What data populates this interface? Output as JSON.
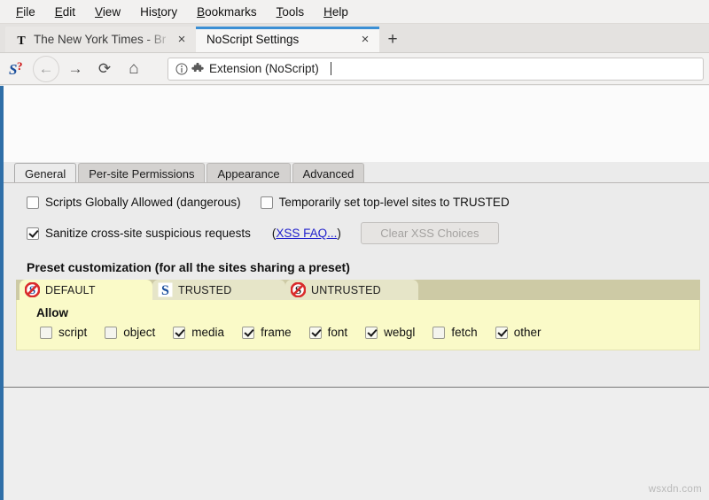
{
  "browser": {
    "menubar": [
      {
        "pre": "",
        "accel": "F",
        "post": "ile"
      },
      {
        "pre": "",
        "accel": "E",
        "post": "dit"
      },
      {
        "pre": "",
        "accel": "V",
        "post": "iew"
      },
      {
        "pre": "His",
        "accel": "t",
        "post": "ory"
      },
      {
        "pre": "",
        "accel": "B",
        "post": "ookmarks"
      },
      {
        "pre": "",
        "accel": "T",
        "post": "ools"
      },
      {
        "pre": "",
        "accel": "H",
        "post": "elp"
      }
    ],
    "tabs": [
      {
        "title": "The New York Times - Br",
        "favicon": "nyt-gothic-t-icon",
        "active": false,
        "close_glyph": "×"
      },
      {
        "title": "NoScript Settings",
        "favicon": "",
        "active": true,
        "close_glyph": "×"
      }
    ],
    "new_tab_glyph": "+",
    "nav": {
      "back_glyph": "←",
      "forward_glyph": "→",
      "reload_glyph": "⟳",
      "home_glyph": "⌂",
      "logo_name": "noscript-logo"
    },
    "urlbar": {
      "value": "Extension (NoScript)",
      "info_icon": "info-icon",
      "extension_icon": "puzzle-piece-icon"
    }
  },
  "options": {
    "tabs": [
      {
        "label": "General",
        "active": true
      },
      {
        "label": "Per-site Permissions",
        "active": false
      },
      {
        "label": "Appearance",
        "active": false
      },
      {
        "label": "Advanced",
        "active": false
      }
    ],
    "general": {
      "scripts_globally_allowed": {
        "label": "Scripts Globally Allowed (dangerous)",
        "checked": false
      },
      "temporarily_trusted": {
        "label": "Temporarily set top-level sites to TRUSTED",
        "checked": false
      },
      "sanitize_requests": {
        "label": "Sanitize cross-site suspicious requests",
        "checked": true
      },
      "xss_faq": {
        "prefix": "(",
        "link": "XSS FAQ...",
        "suffix": ")"
      },
      "clear_xss_button": {
        "label": "Clear XSS Choices",
        "disabled": true
      }
    },
    "preset": {
      "title": "Preset customization (for all the sites sharing a preset)",
      "tabs": [
        {
          "label": "DEFAULT",
          "icon": "noscript-blocked-blue-s-icon",
          "active": true
        },
        {
          "label": "TRUSTED",
          "icon": "noscript-blue-s-icon",
          "active": false
        },
        {
          "label": "UNTRUSTED",
          "icon": "noscript-blocked-dark-s-icon",
          "active": false
        }
      ],
      "allow_label": "Allow",
      "capabilities": [
        {
          "label": "script",
          "checked": false
        },
        {
          "label": "object",
          "checked": false
        },
        {
          "label": "media",
          "checked": true
        },
        {
          "label": "frame",
          "checked": true
        },
        {
          "label": "font",
          "checked": true
        },
        {
          "label": "webgl",
          "checked": true
        },
        {
          "label": "fetch",
          "checked": false
        },
        {
          "label": "other",
          "checked": true
        }
      ]
    }
  },
  "watermark": "wsxdn.com",
  "colors": {
    "active_tab_accent": "#3b8fd4",
    "link": "#2222cc",
    "preset_panel_bg": "#fafac8",
    "preset_strip_bg": "#cdcaa5",
    "page_strip_blue": "#2f6fa8"
  }
}
